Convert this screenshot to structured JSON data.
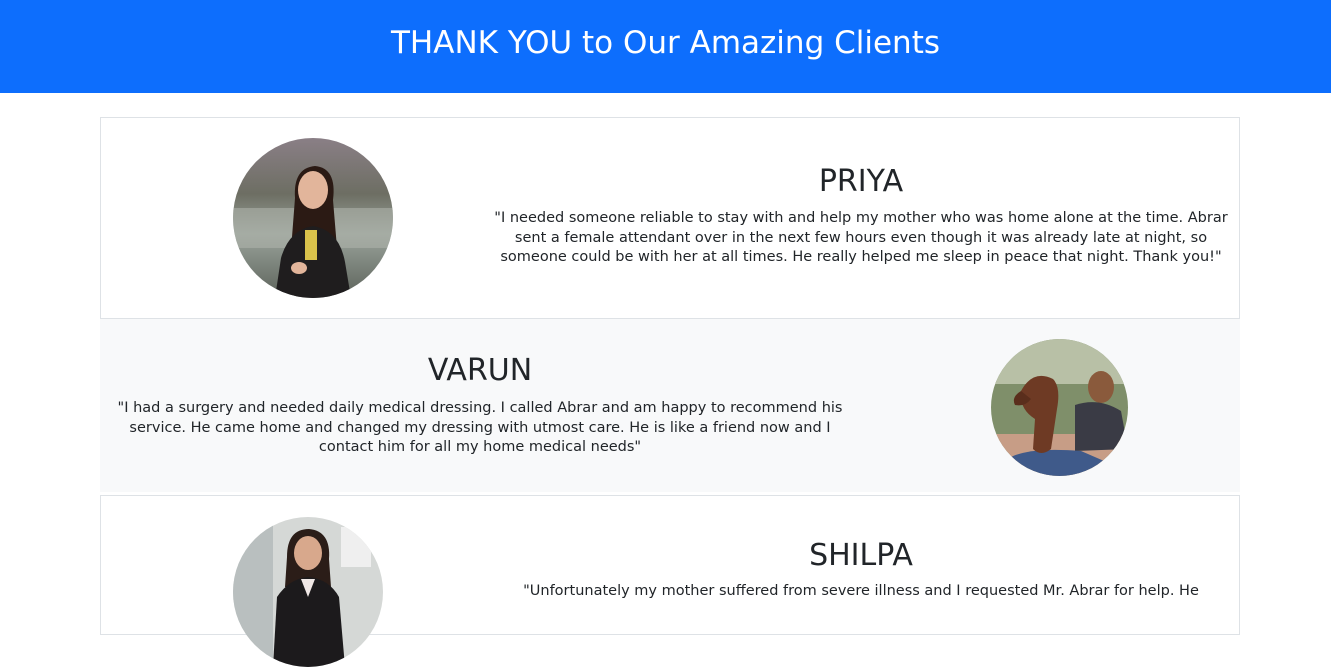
{
  "header": {
    "title": "THANK YOU to Our Amazing Clients",
    "background": "#0d6efd"
  },
  "testimonials": [
    {
      "name": "PRIYA",
      "quote": "\"I needed someone reliable to stay with and help my mother who was home alone at the time. Abrar sent a female attendant over in the next few hours even though it was already late at night, so someone could be with her at all times. He really helped me sleep in peace that night. Thank you!\"",
      "avatar": "woman-outdoors-photo"
    },
    {
      "name": "VARUN",
      "quote": "\"I had a surgery and needed daily medical dressing. I called Abrar and am happy to recommend his service. He came home and changed my dressing with utmost care. He is like a friend now and I contact him for all my home medical needs\"",
      "avatar": "man-with-dog-photo"
    },
    {
      "name": "SHILPA",
      "quote": "\"Unfortunately my mother suffered from severe illness and I requested Mr. Abrar for help. He",
      "avatar": "woman-office-photo"
    }
  ]
}
